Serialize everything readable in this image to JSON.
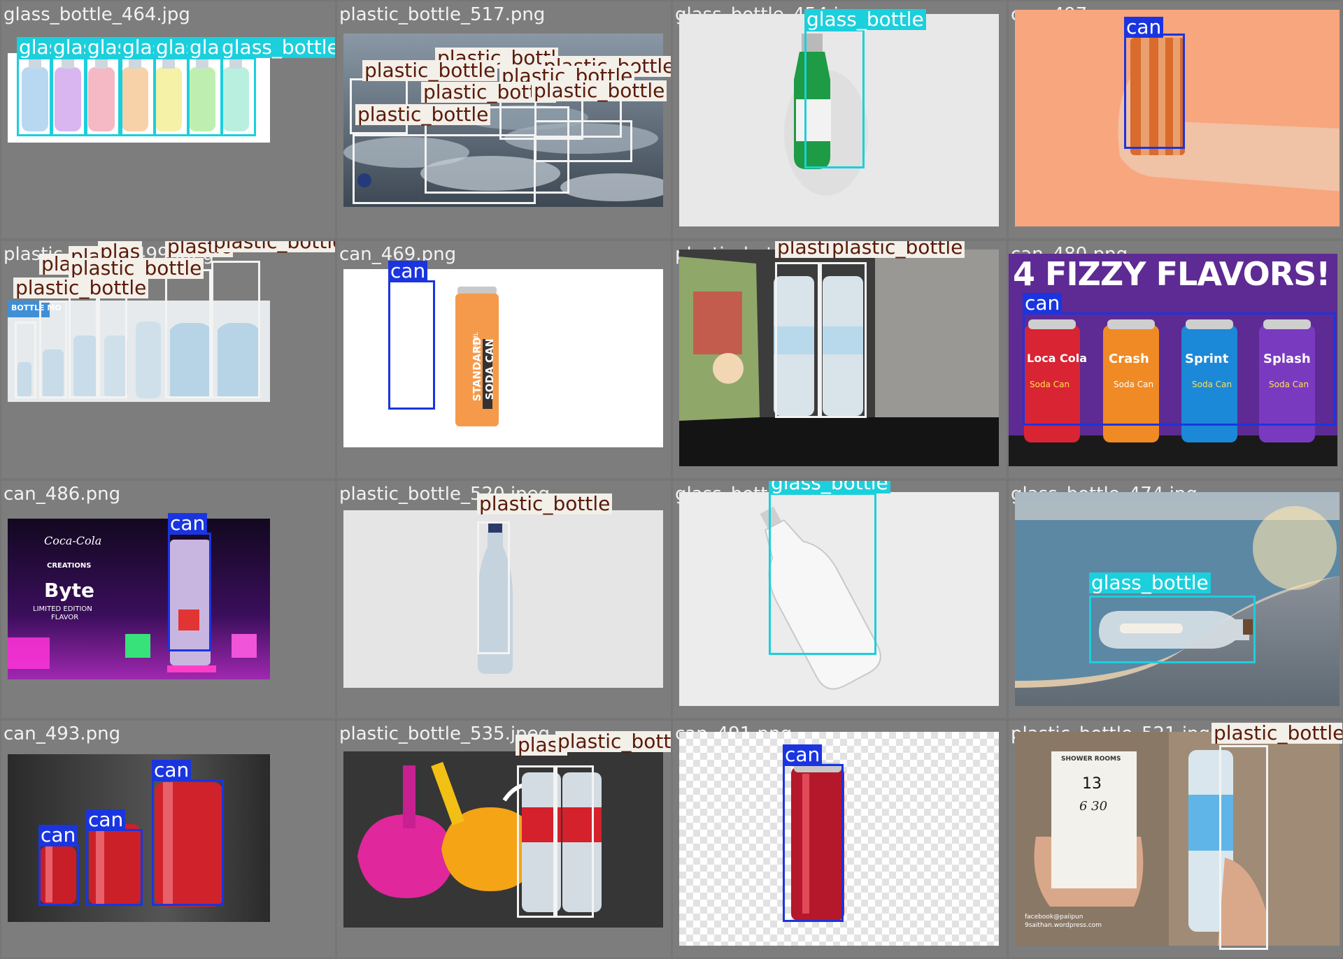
{
  "tiles": [
    {
      "filename": "glass_bottle_464.jpg",
      "labels": [
        "glas",
        "glas",
        "glas",
        "glas",
        "glas",
        "glas",
        "glass_bottle"
      ]
    },
    {
      "filename": "plastic_bottle_517.png",
      "labels": [
        "plastic_bottl",
        "plastic_bottle",
        "plastic_bottle",
        "plastic_bottle",
        "plastic_bottle",
        "plastic_bottle",
        "plastic_bottle"
      ]
    },
    {
      "filename": "glass_bottle_454.jpg",
      "labels": [
        "glass_bottle"
      ]
    },
    {
      "filename": "can_497.png",
      "labels": [
        "can"
      ]
    },
    {
      "filename": "plastic_bottle_499.jpeg",
      "labels": [
        "plas",
        "plas",
        "plas",
        "plastic",
        "plastic_bottle",
        "plastic_bottle",
        "plastic_bottle"
      ]
    },
    {
      "filename": "can_469.png",
      "labels": [
        "can"
      ]
    },
    {
      "filename": "plastic_bottle_503.png",
      "labels": [
        "plastic",
        "plastic_bottle"
      ]
    },
    {
      "filename": "can_480.png",
      "labels": [
        "can"
      ]
    },
    {
      "filename": "can_486.png",
      "labels": [
        "can"
      ]
    },
    {
      "filename": "plastic_bottle_520.jpeg",
      "labels": [
        "plastic_bottle"
      ]
    },
    {
      "filename": "glass_bottle_472.jpg",
      "labels": [
        "glass_bottle"
      ]
    },
    {
      "filename": "glass_bottle_474.jpg",
      "labels": [
        "glass_bottle"
      ]
    },
    {
      "filename": "can_493.png",
      "labels": [
        "can",
        "can",
        "can"
      ]
    },
    {
      "filename": "plastic_bottle_535.jpeg",
      "labels": [
        "plast",
        "plastic_bottle"
      ]
    },
    {
      "filename": "can_491.png",
      "labels": [
        "can"
      ]
    },
    {
      "filename": "plastic_bottle_521.jpg",
      "labels": [
        "plastic_bottle"
      ]
    }
  ],
  "photo_text": {
    "fizzy_banner": "4 FIZZY FLAVORS!",
    "bottle_mock": "BOTTLE MO",
    "soda_can_text": "STANDARD SODA CAN",
    "soda_can_volume": "500ML",
    "cc_creations_brand": "Coca-Cola",
    "cc_creations_sub": "CREATIONS",
    "byte_title": "Byte",
    "byte_sub1": "LIMITED EDITION",
    "byte_sub2": "FLAVOR",
    "ticket_head": "SHOWER ROOMS",
    "ticket_number": "13",
    "ticket_handwritten": "6 30",
    "ticket_credit1": "facebook@paiipun",
    "ticket_credit2": "9saithan.wordpress.com",
    "can1_brand": "Loca Cola",
    "can2_brand": "Crash",
    "can3_brand": "Sprint",
    "can4_brand": "Splash",
    "can_sub": "Soda Can"
  },
  "colors": {
    "can": "#1a35e0",
    "glass_bottle": "#1ccfdc",
    "plastic_bottle": "#f3efe9",
    "plastic_bottle_text": "#5a1a08"
  }
}
